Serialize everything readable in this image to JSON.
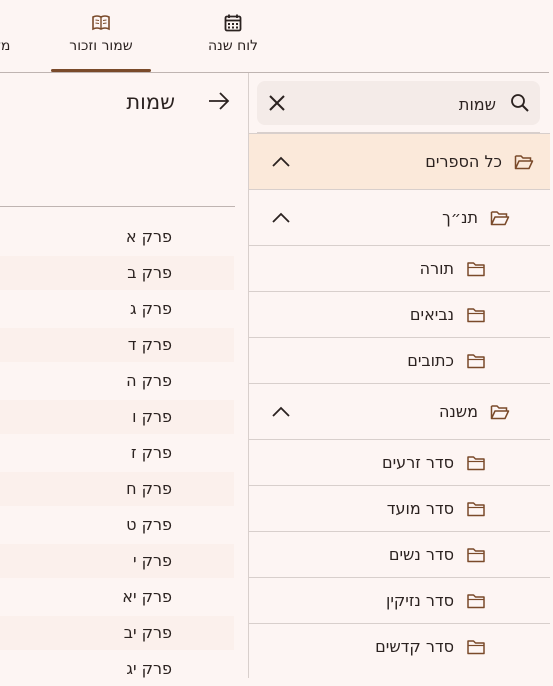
{
  "nav": {
    "tabs": [
      {
        "label": "מז",
        "icon": "partial-tab"
      },
      {
        "label": "שמור וזכור",
        "icon": "book-open-icon",
        "selected": true
      },
      {
        "label": "לוח שנה",
        "icon": "calendar-icon"
      }
    ]
  },
  "search": {
    "value": "שמות"
  },
  "tree": [
    {
      "label": "כל הספרים",
      "level": 0,
      "expanded": true,
      "highlighted": true
    },
    {
      "label": "תנ״ך",
      "level": 1,
      "expanded": true
    },
    {
      "label": "תורה",
      "level": 2
    },
    {
      "label": "נביאים",
      "level": 2
    },
    {
      "label": "כתובים",
      "level": 2
    },
    {
      "label": "משנה",
      "level": 1,
      "expanded": true
    },
    {
      "label": "סדר זרעים",
      "level": 2
    },
    {
      "label": "סדר מועד",
      "level": 2
    },
    {
      "label": "סדר נשים",
      "level": 2
    },
    {
      "label": "סדר נזיקין",
      "level": 2
    },
    {
      "label": "סדר קדשים",
      "level": 2
    }
  ],
  "content": {
    "title": "שמות",
    "chapters": [
      "פרק א",
      "פרק ב",
      "פרק ג",
      "פרק ד",
      "פרק ה",
      "פרק ו",
      "פרק ז",
      "פרק ח",
      "פרק ט",
      "פרק י",
      "פרק יא",
      "פרק יב",
      "פרק יג"
    ]
  },
  "colors": {
    "accent": "#7a4a2a",
    "highlight": "#fbe9da",
    "background": "#fdf5f3"
  }
}
